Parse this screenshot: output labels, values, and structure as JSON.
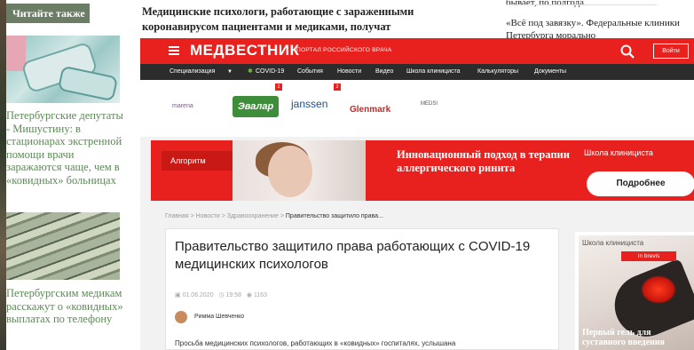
{
  "left": {
    "badge": "Читайте также",
    "news": [
      {
        "text": "Петербургские депутаты - Мишустину: в стационарах экстренной помощи врачи заражаются чаще, чем в «ковидных» больницах"
      },
      {
        "text": "Петербургским медикам расскажут о «ковидных» выплатах по телефону"
      }
    ]
  },
  "top": {
    "headline": "Медицинские психологи, работающие с зараженными коронавирусом пациентами и медиками, получат",
    "right_fragment": "бывает, по полгода",
    "right_link": "«Всё под завязку». Федеральные клиники Петербурга морально"
  },
  "site": {
    "logo": "МЕДВЕСТНИК",
    "tagline": "ПОРТАЛ РОССИЙСКОГО ВРАЧА",
    "login": "Войти",
    "nav": [
      "Специализация",
      "COVID-19",
      "События",
      "Новости",
      "Видео",
      "Школа клинициста",
      "Калькуляторы",
      "Документы"
    ],
    "sponsors": [
      "marena",
      "Эвалар",
      "janssen",
      "Glenmark",
      "MEDSI"
    ],
    "sponsor_badges": [
      "2",
      "2"
    ],
    "banner": {
      "label": "Алгоритм",
      "title": "Инновационный подход в терапии аллергического ринита",
      "school": "Школа клинициста",
      "button": "Подробнее"
    },
    "breadcrumb": [
      "Главная",
      "Новости",
      "Здравоохранение"
    ],
    "breadcrumb_current": "Правительство защитило права...",
    "article": {
      "title": "Правительство защитило права работающих с COVID-19 медицинских психологов",
      "date": "01.06.2020",
      "time": "19:58",
      "views": "1163",
      "author": "Римма Шевченко",
      "lead": "Просьба медицинских психологов, работающих в «ковидных» госпиталях, услышана"
    },
    "side": {
      "school": "Школа клинициста",
      "badge": "In brevis",
      "title": "Первый гель для суставного введения"
    }
  }
}
